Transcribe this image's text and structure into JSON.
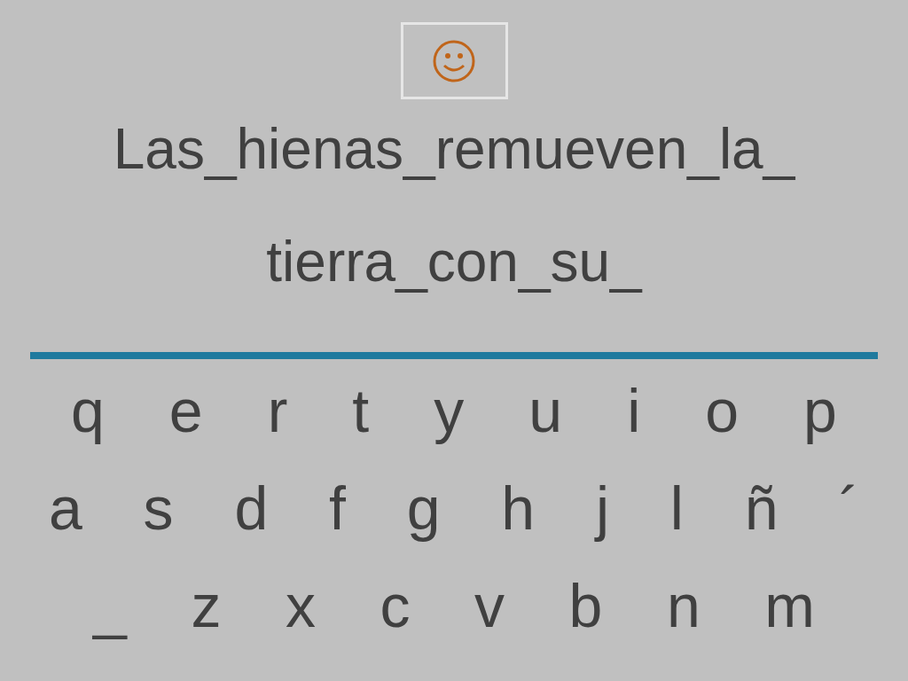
{
  "phrase_lines": [
    "Las_hienas_remueven_la_",
    "tierra_con_su_"
  ],
  "keyboard_rows": [
    [
      "q",
      "e",
      "r",
      "t",
      "y",
      "u",
      "i",
      "o",
      "p"
    ],
    [
      "a",
      "s",
      "d",
      "f",
      "g",
      "h",
      "j",
      "l",
      "ñ",
      "´"
    ],
    [
      "_",
      "z",
      "x",
      "c",
      "v",
      "b",
      "n",
      "m"
    ]
  ]
}
